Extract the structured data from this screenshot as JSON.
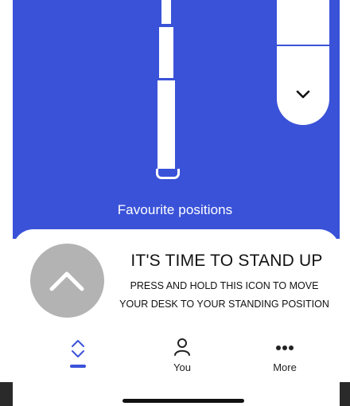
{
  "colors": {
    "accent": "#3a52d8",
    "button_grey": "#b3b3b3"
  },
  "desk": {
    "dropdown_icon": "chevron-down-icon"
  },
  "favourites": {
    "label": "Favourite positions"
  },
  "stand_prompt": {
    "button_icon": "chevron-up-icon",
    "headline": "IT'S TIME TO STAND UP",
    "instruction_line1": "PRESS AND HOLD THIS ICON TO MOVE",
    "instruction_line2": "YOUR DESK TO YOUR STANDING POSITION"
  },
  "tabbar": {
    "tabs": [
      {
        "label": "",
        "icon": "up-down-arrows-icon",
        "active": true
      },
      {
        "label": "You",
        "icon": "person-icon",
        "active": false
      },
      {
        "label": "More",
        "icon": "more-dots-icon",
        "active": false
      }
    ]
  }
}
